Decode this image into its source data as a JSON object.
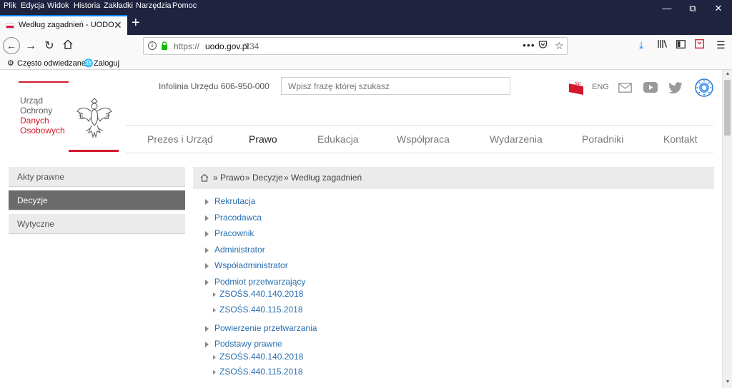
{
  "menubar": {
    "items": [
      "Plik",
      "Edycja",
      "Widok",
      "Historia",
      "Zakładki",
      "Narzędzia",
      "Pomoc"
    ]
  },
  "tab": {
    "title": "Według zagadnień - UODO"
  },
  "urlbar": {
    "protocol": "https://",
    "domain": "uodo.gov.pl",
    "path": "/234"
  },
  "bookmarks": {
    "items": [
      "Często odwiedzane",
      "Zaloguj"
    ]
  },
  "site": {
    "logo_lines": [
      "Urząd",
      "Ochrony",
      "Danych",
      "Osobowych"
    ],
    "hotline": "Infolinia Urzędu 606-950-000",
    "search_placeholder": "Wpisz frazę której szukasz",
    "bip_label": "bip",
    "lang_label": "ENG",
    "nav": [
      "Prezes i Urząd",
      "Prawo",
      "Edukacja",
      "Współpraca",
      "Wydarzenia",
      "Poradniki",
      "Kontakt"
    ],
    "nav_active": "Prawo"
  },
  "sidebar": {
    "items": [
      "Akty prawne",
      "Decyzje",
      "Wytyczne"
    ],
    "active": "Decyzje"
  },
  "breadcrumb": {
    "items": [
      "» Prawo",
      "» Decyzje",
      "» Według zagadnień"
    ]
  },
  "tree": [
    {
      "label": "Rekrutacja",
      "children": []
    },
    {
      "label": "Pracodawca",
      "children": []
    },
    {
      "label": "Pracownik",
      "children": []
    },
    {
      "label": "Administrator",
      "children": []
    },
    {
      "label": "Współadministrator",
      "children": []
    },
    {
      "label": "Podmiot przetwarzający",
      "children": [
        "ZSOŚS.440.140.2018",
        "ZSOŚS.440.115.2018"
      ]
    },
    {
      "label": "Powierzenie przetwarzania",
      "children": []
    },
    {
      "label": "Podstawy prawne",
      "children": [
        "ZSOŚS.440.140.2018",
        "ZSOŚS.440.115.2018"
      ]
    }
  ],
  "colors": {
    "chrome_dark": "#202340",
    "accent_red": "#d3172d",
    "link_blue": "#2a6fb1",
    "tab_highlight": "#0a84ff"
  }
}
